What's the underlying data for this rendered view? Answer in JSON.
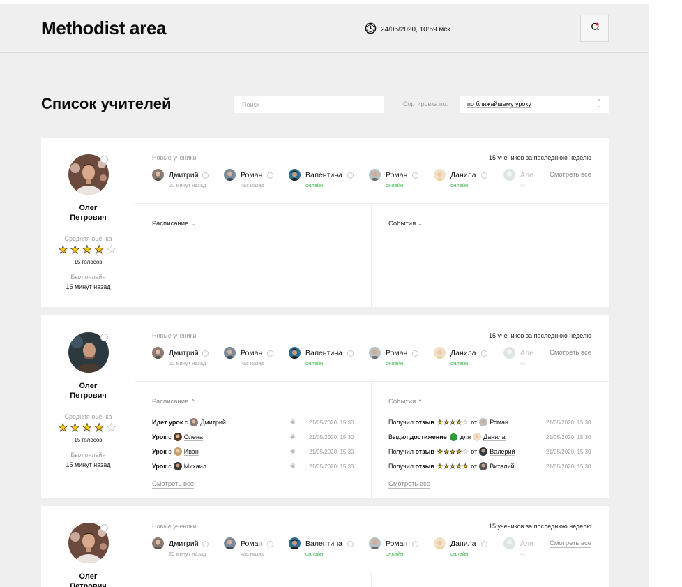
{
  "header": {
    "title": "Methodist area",
    "datetime": "24/05/2020, 10:59 мск"
  },
  "page": {
    "title": "Список учителей",
    "search_placeholder": "Поиск",
    "sort_label": "Сортировка по:",
    "sort_value": "по ближайшему уроку"
  },
  "labels": {
    "avg_rating": "Средняя оценка",
    "last_online": "Был онлайн",
    "new_students": "Новые ученики",
    "week_count": "15 учеников за последнюю неделю",
    "see_all": "Смотреть все",
    "schedule": "Расписание",
    "events": "События"
  },
  "teachers": [
    {
      "name_first": "Олег",
      "name_last": "Петрович",
      "rating": 4,
      "votes": "15 голосов",
      "last_seen": "15 минут назад"
    },
    {
      "name_first": "Олег",
      "name_last": "Петрович",
      "rating": 4,
      "votes": "15 голосов",
      "last_seen": "15 минут назад"
    },
    {
      "name_first": "Олег",
      "name_last": "Петрович"
    }
  ],
  "students": [
    {
      "name": "Дмитрий",
      "sub": "20 минут назад",
      "online": false
    },
    {
      "name": "Роман",
      "sub": "час назад",
      "online": false
    },
    {
      "name": "Валентина",
      "sub": "онлайн",
      "online": true
    },
    {
      "name": "Роман",
      "sub": "онлайн",
      "online": true
    },
    {
      "name": "Данила",
      "sub": "онлайн",
      "online": true
    },
    {
      "name": "Але",
      "sub": "нс",
      "online": false
    }
  ],
  "schedule": [
    {
      "status": "Идет урок",
      "prep": "с",
      "student": "Дмитрий",
      "date": "21/05/2020, 15:30"
    },
    {
      "status": "Урок",
      "prep": "с",
      "student": "Олена",
      "date": "21/05/2020, 15:30"
    },
    {
      "status": "Урок",
      "prep": "с",
      "student": "Иван",
      "date": "21/05/2020, 15:30"
    },
    {
      "status": "Урок",
      "prep": "с",
      "student": "Михаил",
      "date": "21/05/2020, 15:30"
    }
  ],
  "events": [
    {
      "action": "Получил",
      "object": "отзыв",
      "rating": 4,
      "link": "от",
      "student": "Роман",
      "date": "21/05/2020, 15:30"
    },
    {
      "action": "Выдал",
      "object": "достижение",
      "badge": true,
      "link": "для",
      "student": "Данила",
      "date": "21/05/2020, 15:30"
    },
    {
      "action": "Получил",
      "object": "отзыв",
      "rating": 4,
      "link": "от",
      "student": "Валерий",
      "date": "21/05/2020, 15:30"
    },
    {
      "action": "Получил",
      "object": "отзыв",
      "rating": 5,
      "link": "от",
      "student": "Виталий",
      "date": "21/05/2020, 15:30"
    }
  ],
  "colors": {
    "background": "#efeff0",
    "card": "#ffffff",
    "online": "#3bb54a",
    "star": "#f5c518",
    "notification_dot": "#e0262b"
  }
}
